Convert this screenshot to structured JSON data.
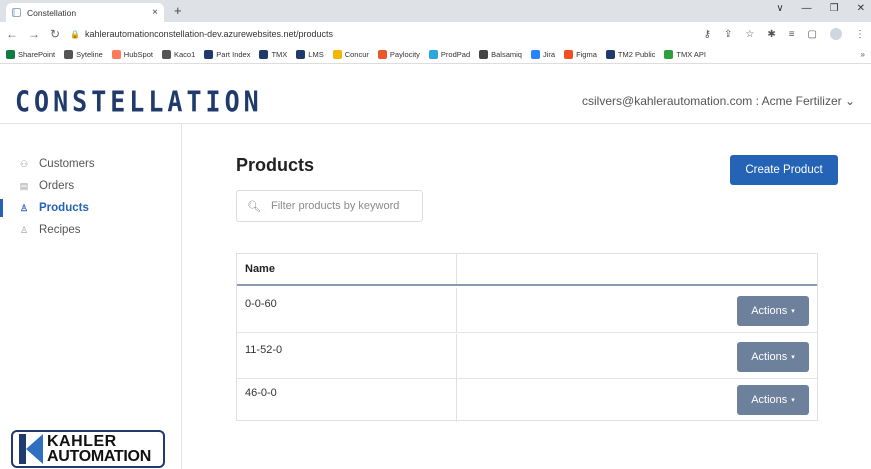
{
  "browser": {
    "tab_title": "Constellation",
    "tab_close": "×",
    "new_tab": "+",
    "window_controls": [
      "∨",
      "—",
      "❐",
      "✕"
    ],
    "url": "kahlerautomationconstellation-dev.azurewebsites.net/products",
    "bookmarks": [
      {
        "label": "SharePoint",
        "color": "#107c41"
      },
      {
        "label": "Syteline",
        "color": "#555555"
      },
      {
        "label": "HubSpot",
        "color": "#ff7a59"
      },
      {
        "label": "Kaco1",
        "color": "#555555"
      },
      {
        "label": "Part Index",
        "color": "#1f3a6b"
      },
      {
        "label": "TMX",
        "color": "#1f3a6b"
      },
      {
        "label": "LMS",
        "color": "#1f3a6b"
      },
      {
        "label": "Concur",
        "color": "#f2b705"
      },
      {
        "label": "Paylocity",
        "color": "#e9572b"
      },
      {
        "label": "ProdPad",
        "color": "#2aa7df"
      },
      {
        "label": "Balsamiq",
        "color": "#444444"
      },
      {
        "label": "Jira",
        "color": "#2684ff"
      },
      {
        "label": "Figma",
        "color": "#f24e1e"
      },
      {
        "label": "TM2 Public",
        "color": "#1f3a6b"
      },
      {
        "label": "TMX API",
        "color": "#2e9e3e"
      }
    ],
    "bookmarks_more": "»"
  },
  "header": {
    "logo": "CONSTELLATION",
    "account": "csilvers@kahlerautomation.com : Acme Fertilizer ⌄"
  },
  "sidebar": {
    "items": [
      {
        "label": "Customers",
        "icon": "users-icon",
        "glyph": "⚇"
      },
      {
        "label": "Orders",
        "icon": "document-icon",
        "glyph": "▤"
      },
      {
        "label": "Products",
        "icon": "products-icon",
        "glyph": "♙"
      },
      {
        "label": "Recipes",
        "icon": "recipes-icon",
        "glyph": "♙"
      }
    ],
    "brand_line1": "KAHLER",
    "brand_line2": "AUTOMATION"
  },
  "main": {
    "title": "Products",
    "create_button": "Create Product",
    "search_placeholder": "Filter products by keyword",
    "table": {
      "columns": [
        "Name",
        ""
      ],
      "rows": [
        {
          "name": "0-0-60",
          "action": "Actions"
        },
        {
          "name": "11-52-0",
          "action": "Actions"
        },
        {
          "name": "46-0-0",
          "action": "Actions"
        }
      ]
    }
  },
  "colors": {
    "primary": "#2563b6",
    "actions": "#6d809c",
    "logo": "#1f3a6b"
  }
}
